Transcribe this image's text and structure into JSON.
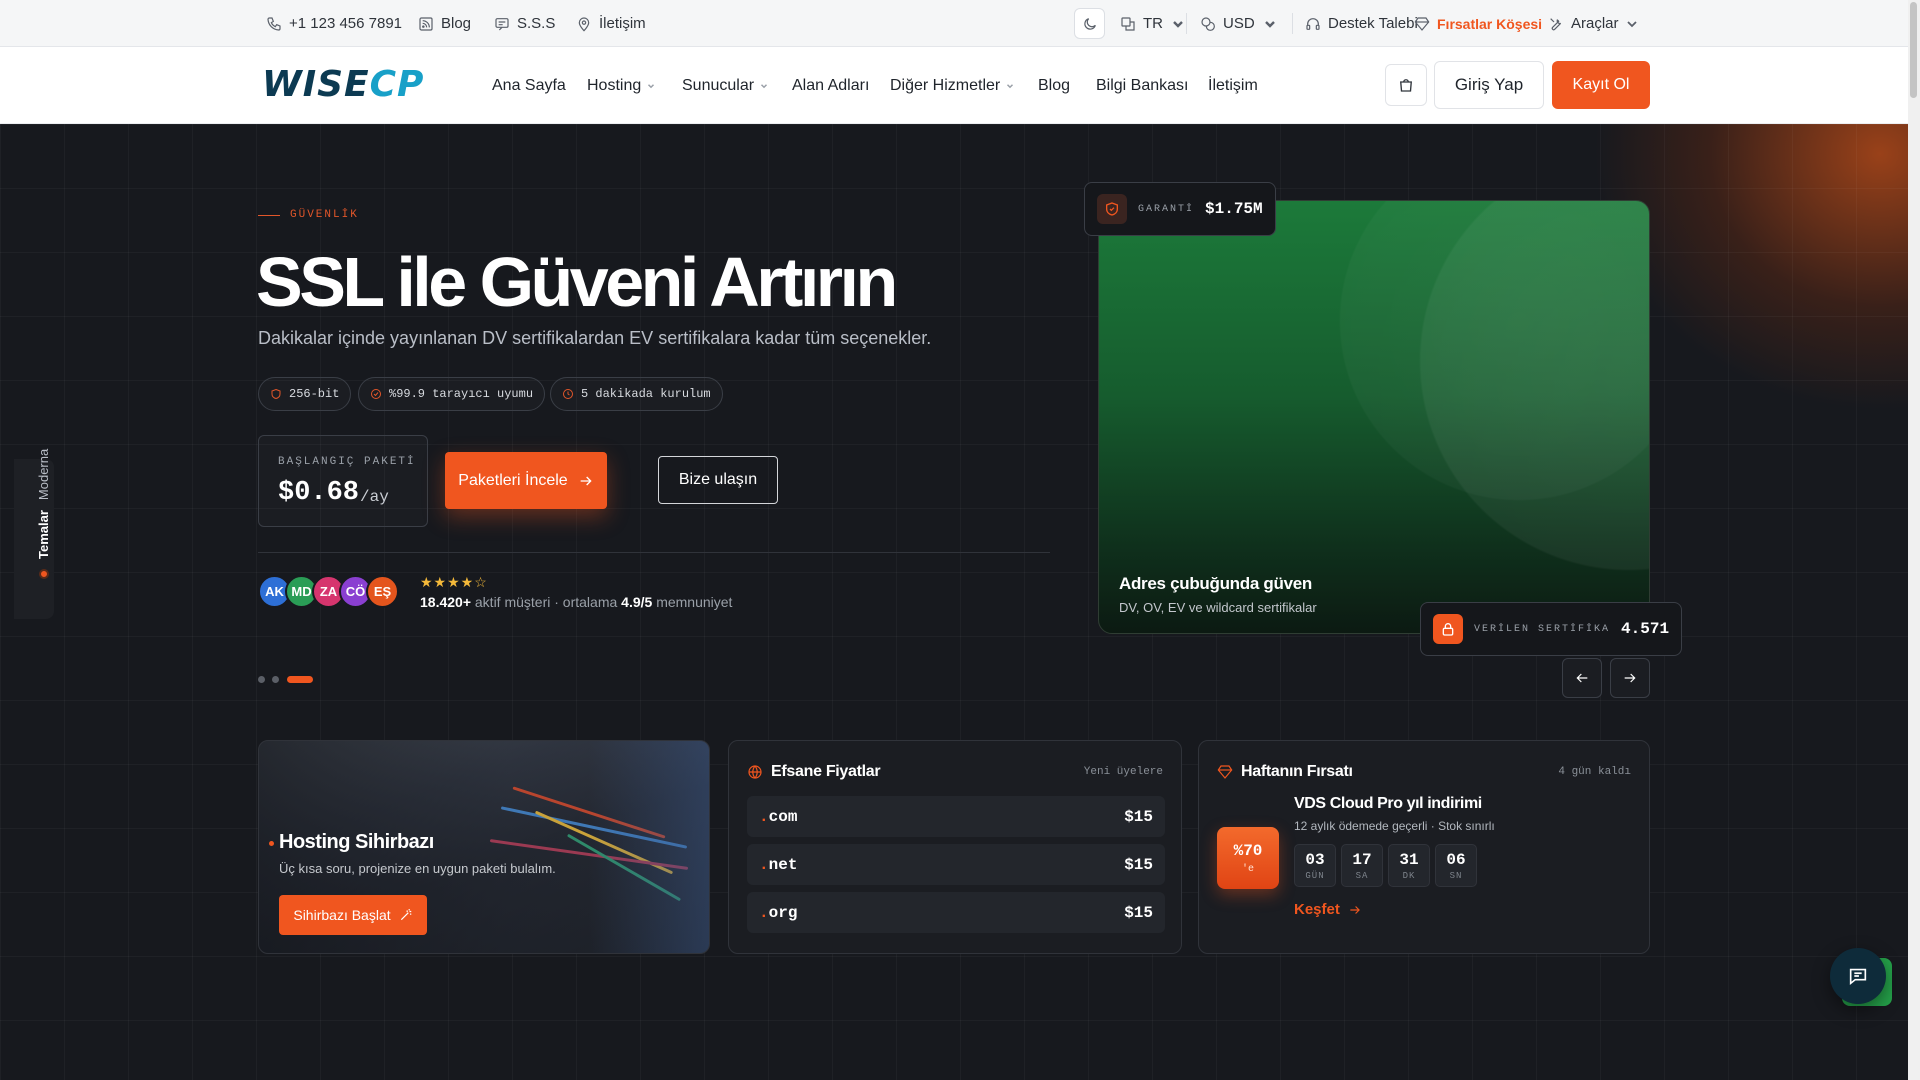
{
  "topbar": {
    "phone": "+1 123 456 7891",
    "blog": "Blog",
    "faq": "S.S.S",
    "contact": "İletişim",
    "language": "TR",
    "currency": "USD",
    "support": "Destek Talebi",
    "deals": "Fırsatlar Köşesi",
    "tools": "Araçlar",
    "deals_color": "#f0561f"
  },
  "nav": {
    "logo_left": "WISE",
    "logo_right": "CP",
    "items": [
      "Ana Sayfa",
      "Hosting",
      "Sunucular",
      "Alan Adları",
      "Diğer Hizmetler",
      "Blog",
      "Bilgi Bankası",
      "İletişim"
    ],
    "login": "Giriş Yap",
    "register": "Kayıt Ol",
    "accent": "#f0561f"
  },
  "side_tab": {
    "label": "Temalar",
    "value": "Moderna"
  },
  "hero": {
    "eyebrow": "GÜVENLİK",
    "title": "SSL ile Güveni Artırın",
    "subtitle": "Dakikalar içinde yayınlanan DV sertifikalardan EV sertifikalara kadar tüm seçenekler.",
    "chips": [
      "256-bit",
      "%99.9 tarayıcı uyumu",
      "5 dakikada kurulum"
    ],
    "price_label": "BAŞLANGIÇ PAKETİ",
    "price": "$0.68",
    "price_unit": "/ay",
    "cta_primary": "Paketleri İncele",
    "cta_secondary": "Bize ulaşın",
    "avatars": [
      {
        "initials": "AK",
        "color": "#2d6fd6"
      },
      {
        "initials": "MD",
        "color": "#2a9d56"
      },
      {
        "initials": "ZA",
        "color": "#d6356e"
      },
      {
        "initials": "CÖ",
        "color": "#8a3fd1"
      },
      {
        "initials": "EŞ",
        "color": "#e4551d"
      }
    ],
    "rating_stars": 4.5,
    "stars_text": "★★★★☆",
    "customers": "18.420+",
    "customers_label": "aktif müşteri · ortalama",
    "rating": "4.9/5",
    "rating_label": "memnuniyet",
    "slides_total": 3,
    "slide_active": 3
  },
  "feature_card": {
    "title": "Adres çubuğunda güven",
    "subtitle": "DV, OV, EV ve wildcard sertifikalar",
    "badge_top_label": "GARANTİ",
    "badge_top_value": "$1.75M",
    "badge_bottom_label": "VERİLEN SERTİFİKA",
    "badge_bottom_value": "4.571"
  },
  "panels": {
    "wizard": {
      "title": "Hosting Sihirbazı",
      "text": "Üç kısa soru, projenize en uygun paketi bulalım.",
      "button": "Sihirbazı Başlat"
    },
    "prices": {
      "title": "Efsane Fiyatlar",
      "tag": "Yeni üyelere",
      "domains": [
        {
          "ext": "com",
          "price": "$15"
        },
        {
          "ext": "net",
          "price": "$15"
        },
        {
          "ext": "org",
          "price": "$15"
        }
      ]
    },
    "deal": {
      "title": "Haftanın Fırsatı",
      "tag": "4 gün kaldı",
      "discount": "%70",
      "discount_suffix": "'e",
      "name": "VDS Cloud Pro yıl indirimi",
      "desc": "12 aylık ödemede geçerli · Stok sınırlı",
      "countdown": [
        {
          "value": "03",
          "unit": "GÜN"
        },
        {
          "value": "17",
          "unit": "SA"
        },
        {
          "value": "31",
          "unit": "DK"
        },
        {
          "value": "06",
          "unit": "SN"
        }
      ],
      "link": "Keşfet"
    }
  }
}
